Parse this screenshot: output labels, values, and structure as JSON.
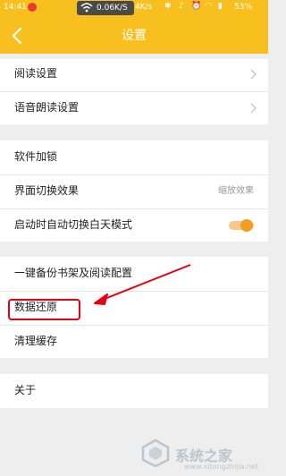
{
  "status_bar": {
    "time": "14:41",
    "net_speed": "0.06K/S",
    "net_speed2": "4K/s",
    "battery": "53%"
  },
  "header": {
    "title": "设置"
  },
  "group1": [
    {
      "label": "阅读设置"
    },
    {
      "label": "语音朗读设置"
    }
  ],
  "group2": {
    "software_lock": "软件加锁",
    "transition_label": "界面切换效果",
    "transition_value": "缩放效果",
    "auto_day_mode": "启动时自动切换白天模式",
    "auto_day_mode_on": true
  },
  "group3": {
    "backup": "一键备份书架及阅读配置",
    "restore": "数据还原",
    "clear_cache": "清理缓存"
  },
  "group4": {
    "about": "关于"
  },
  "watermark": {
    "text": "系统之家",
    "url": "www.xitongzhijia.net"
  },
  "colors": {
    "accent": "#f7c01e",
    "highlight": "#e60012",
    "toggle": "#f59c23"
  }
}
